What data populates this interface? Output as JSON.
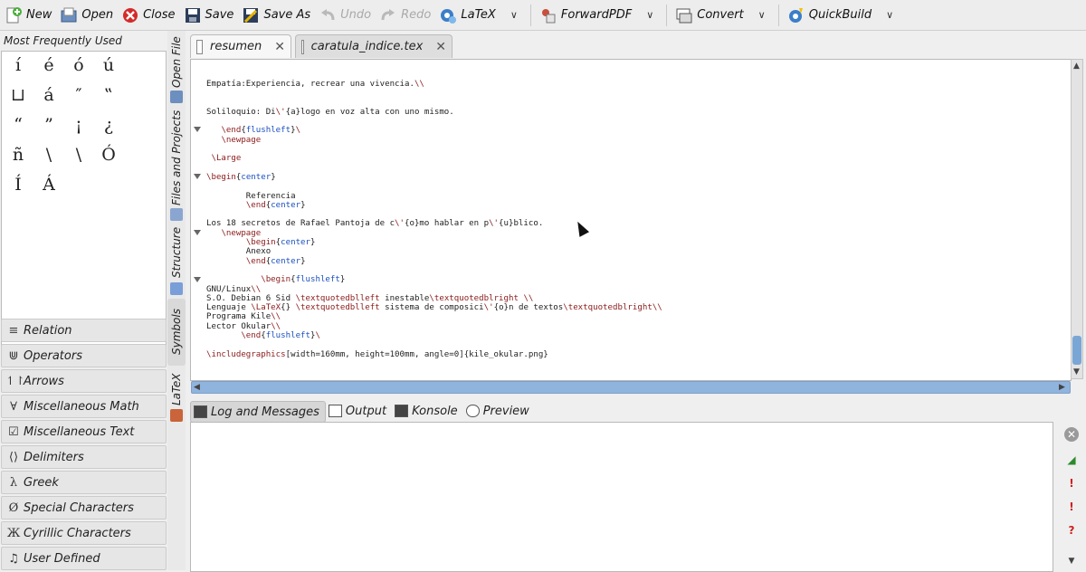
{
  "toolbar": {
    "new": "New",
    "open": "Open",
    "close": "Close",
    "save": "Save",
    "save_as": "Save As",
    "undo": "Undo",
    "redo": "Redo",
    "latex": "LaTeX",
    "forwardpdf": "ForwardPDF",
    "convert": "Convert",
    "quickbuild": "QuickBuild"
  },
  "symbols": {
    "title": "Most Frequently Used",
    "items": [
      "í",
      "é",
      "ó",
      "ú",
      "⊔",
      "á",
      "″",
      "‟",
      "“",
      "”",
      "¡",
      "¿",
      "ñ",
      "\\",
      "\\",
      "Ó",
      "Í",
      "Á"
    ],
    "categories": [
      {
        "icon": "≡",
        "label": "Relation"
      },
      {
        "icon": "⋓",
        "label": "Operators"
      },
      {
        "icon": "↿↾",
        "label": "Arrows"
      },
      {
        "icon": "∀",
        "label": "Miscellaneous Math"
      },
      {
        "icon": "☑",
        "label": "Miscellaneous Text"
      },
      {
        "icon": "⟨⟩",
        "label": "Delimiters"
      },
      {
        "icon": "λ",
        "label": "Greek"
      },
      {
        "icon": "Ø",
        "label": "Special Characters"
      },
      {
        "icon": "Ж",
        "label": "Cyrillic Characters"
      },
      {
        "icon": "♫",
        "label": "User Defined"
      }
    ]
  },
  "side_tabs": {
    "open_file": "Open File",
    "files_projects": "Files and Projects",
    "structure": "Structure",
    "symbols": "Symbols",
    "latex": "LaTeX"
  },
  "editor_tabs": {
    "tab1": "resumen",
    "tab2": "caratula_indice.tex"
  },
  "code": [
    [
      [
        "t",
        "Empatía:Experiencia, recrear una vivencia."
      ],
      [
        "k",
        "\\\\"
      ]
    ],
    [],
    [],
    [
      [
        "t",
        "Soliloquio: Di"
      ],
      [
        "k",
        "\\'"
      ],
      [
        "t",
        "{a}logo en voz alta con uno mismo."
      ]
    ],
    [],
    [
      [
        "t",
        "   "
      ],
      [
        "k",
        "\\end"
      ],
      [
        "t",
        "{"
      ],
      [
        "a",
        "flushleft"
      ],
      [
        "t",
        "}"
      ],
      [
        "k",
        "\\"
      ]
    ],
    [
      [
        "t",
        "   "
      ],
      [
        "k",
        "\\newpage"
      ]
    ],
    [],
    [
      [
        "t",
        " "
      ],
      [
        "k",
        "\\Large"
      ]
    ],
    [],
    [
      [
        "k",
        "\\begin"
      ],
      [
        "t",
        "{"
      ],
      [
        "a",
        "center"
      ],
      [
        "t",
        "}"
      ]
    ],
    [],
    [
      [
        "t",
        "        Referencia"
      ]
    ],
    [
      [
        "t",
        "        "
      ],
      [
        "k",
        "\\end"
      ],
      [
        "t",
        "{"
      ],
      [
        "a",
        "center"
      ],
      [
        "t",
        "}"
      ]
    ],
    [],
    [
      [
        "t",
        "Los 18 secretos de Rafael Pantoja de c"
      ],
      [
        "k",
        "\\'"
      ],
      [
        "t",
        "{o}mo hablar en p"
      ],
      [
        "k",
        "\\'"
      ],
      [
        "t",
        "{u}blico."
      ]
    ],
    [
      [
        "t",
        "   "
      ],
      [
        "k",
        "\\newpage"
      ]
    ],
    [
      [
        "t",
        "        "
      ],
      [
        "k",
        "\\begin"
      ],
      [
        "t",
        "{"
      ],
      [
        "a",
        "center"
      ],
      [
        "t",
        "}"
      ]
    ],
    [
      [
        "t",
        "        Anexo"
      ]
    ],
    [
      [
        "t",
        "        "
      ],
      [
        "k",
        "\\end"
      ],
      [
        "t",
        "{"
      ],
      [
        "a",
        "center"
      ],
      [
        "t",
        "}"
      ]
    ],
    [],
    [
      [
        "t",
        "           "
      ],
      [
        "k",
        "\\begin"
      ],
      [
        "t",
        "{"
      ],
      [
        "a",
        "flushleft"
      ],
      [
        "t",
        "}"
      ]
    ],
    [
      [
        "t",
        "GNU/Linux"
      ],
      [
        "k",
        "\\\\"
      ]
    ],
    [
      [
        "t",
        "S.O. Debian 6 Sid "
      ],
      [
        "k",
        "\\textquotedblleft"
      ],
      [
        "t",
        " inestable"
      ],
      [
        "k",
        "\\textquotedblright"
      ],
      [
        "t",
        " "
      ],
      [
        "k",
        "\\\\"
      ]
    ],
    [
      [
        "t",
        "Lenguaje "
      ],
      [
        "k",
        "\\LaTeX"
      ],
      [
        "t",
        "{} "
      ],
      [
        "k",
        "\\textquotedblleft"
      ],
      [
        "t",
        " sistema de composici"
      ],
      [
        "k",
        "\\'"
      ],
      [
        "t",
        "{o}n de textos"
      ],
      [
        "k",
        "\\textquotedblright"
      ],
      [
        "k",
        "\\\\"
      ]
    ],
    [
      [
        "t",
        "Programa Kile"
      ],
      [
        "k",
        "\\\\"
      ]
    ],
    [
      [
        "t",
        "Lector Okular"
      ],
      [
        "k",
        "\\\\"
      ]
    ],
    [
      [
        "t",
        "       "
      ],
      [
        "k",
        "\\end"
      ],
      [
        "t",
        "{"
      ],
      [
        "a",
        "flushleft"
      ],
      [
        "t",
        "}"
      ],
      [
        "k",
        "\\"
      ]
    ],
    [],
    [
      [
        "k",
        "\\includegraphics"
      ],
      [
        "t",
        "[width=160mm, height=100mm, angle=0]{kile_okular.png}"
      ]
    ]
  ],
  "log_tabs": {
    "log": "Log and Messages",
    "output": "Output",
    "konsole": "Konsole",
    "preview": "Preview"
  },
  "colors": {
    "keyword": "#8b1a1a",
    "argument": "#1a4fc0",
    "accent": "#7aa6d6"
  }
}
